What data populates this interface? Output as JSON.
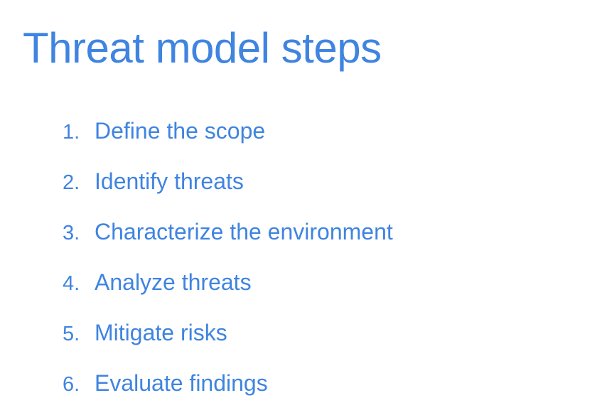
{
  "slide": {
    "title": "Threat model steps",
    "steps": [
      {
        "number": "1.",
        "text": "Define the scope"
      },
      {
        "number": "2.",
        "text": "Identify threats"
      },
      {
        "number": "3.",
        "text": "Characterize the environment"
      },
      {
        "number": "4.",
        "text": "Analyze threats"
      },
      {
        "number": "5.",
        "text": "Mitigate risks"
      },
      {
        "number": "6.",
        "text": "Evaluate findings"
      }
    ]
  },
  "colors": {
    "text": "#3f84e0",
    "background": "#ffffff"
  }
}
